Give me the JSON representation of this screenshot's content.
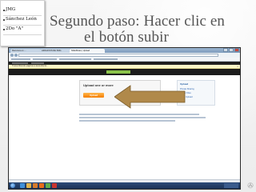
{
  "slide": {
    "note_lines": [
      "JMG",
      "Sánchez León",
      "2Do \"A\""
    ],
    "title_line1": "Segundo paso: Hacer clic en",
    "title_line2": "el botón subir"
  },
  "browser": {
    "tabs": [
      {
        "label": "Recursos en ...",
        "active": false
      },
      {
        "label": "ARCHIVOS DE SMG",
        "active": false
      },
      {
        "label": "SlideShare | Upload",
        "active": true
      }
    ],
    "notice": "Transcribiendo páginas a ascendente...",
    "upload_panel": {
      "title": "Upload one or more",
      "button": "Upload"
    },
    "side_panel": {
      "title": "Upload",
      "links": [
        "Private Sharing",
        "Larger Files",
        "Video Upload"
      ]
    }
  },
  "colors": {
    "title_color": "#555555",
    "arrow_fill": "#b0894a",
    "upload_button": "#f57c00"
  },
  "icons": [
    "start-orb-icon",
    "ie-icon",
    "folder-icon",
    "media-icon",
    "firefox-icon",
    "chrome-icon",
    "pdf-icon",
    "arrow-icon"
  ]
}
